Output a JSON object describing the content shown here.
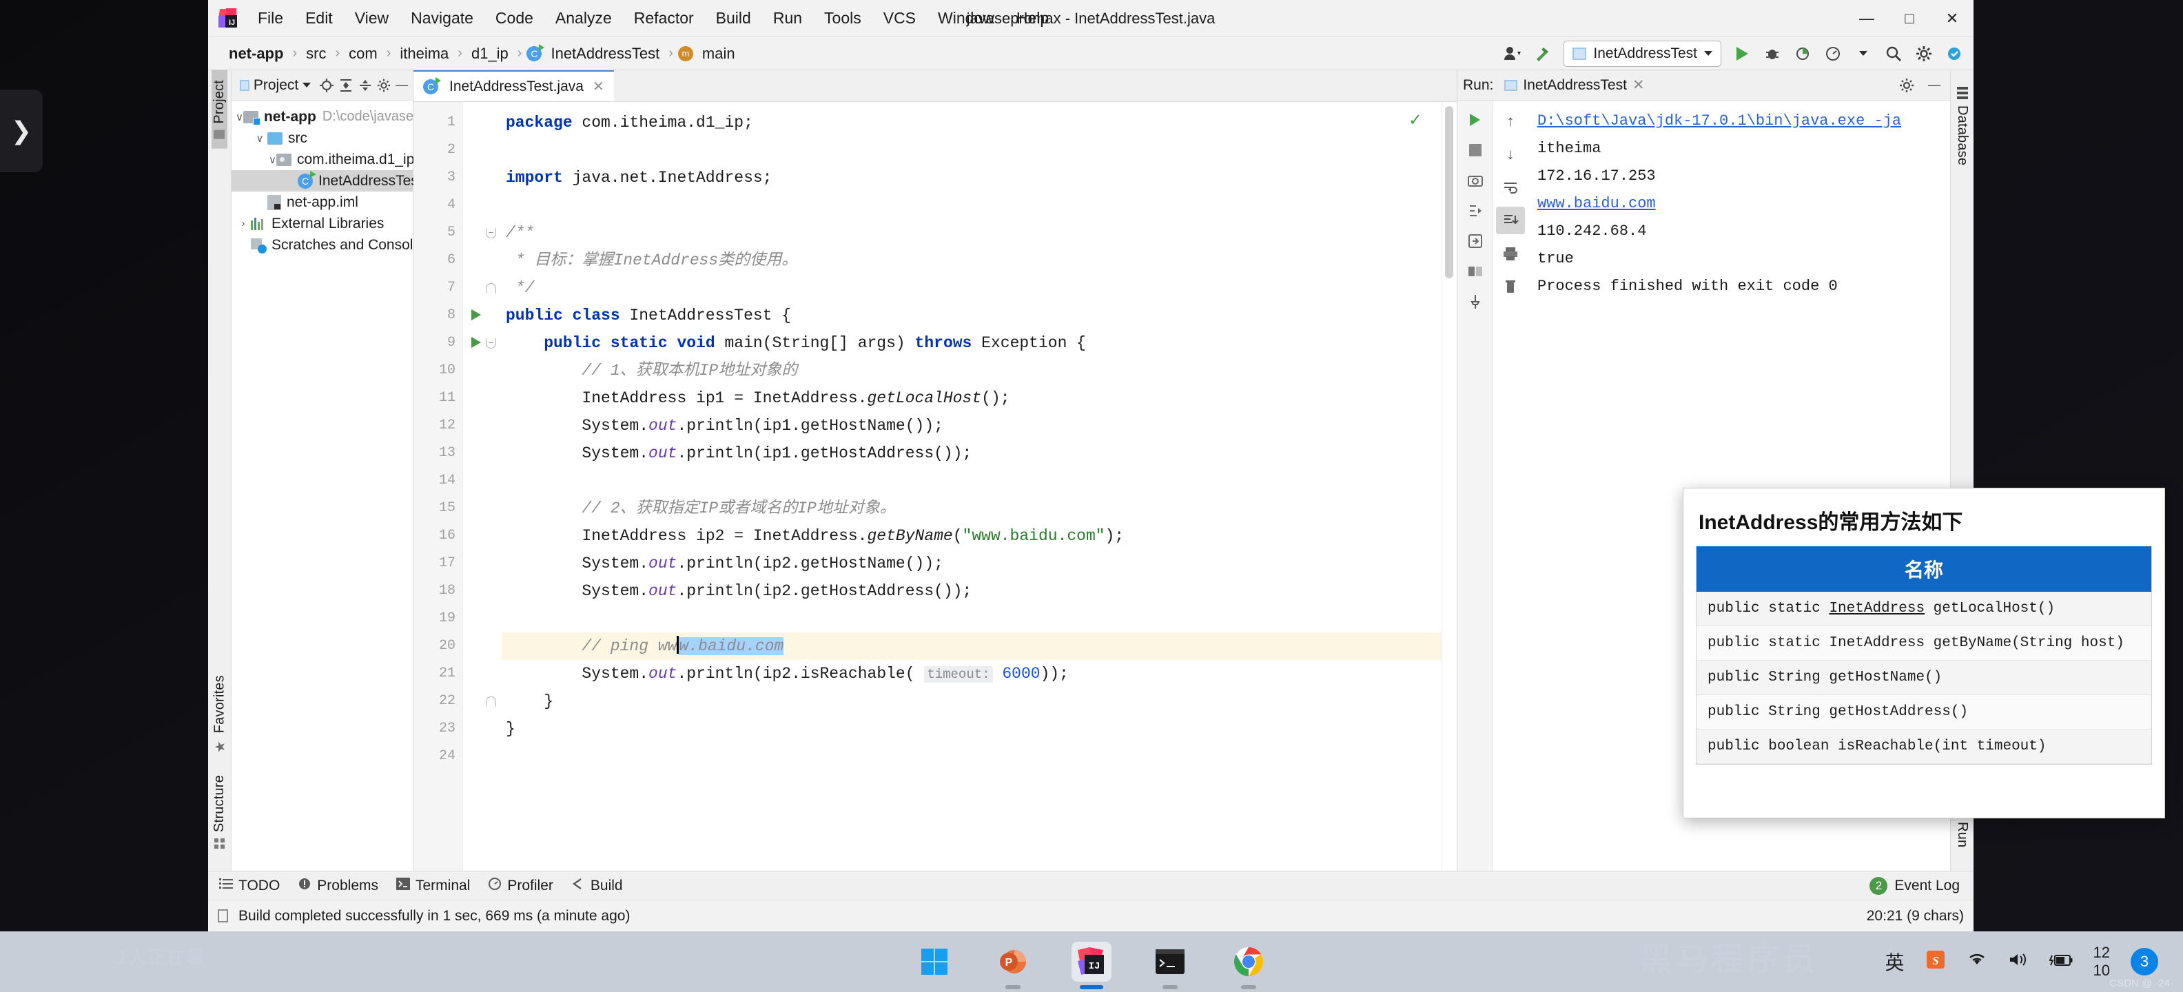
{
  "window": {
    "title": "javasepromax - InetAddressTest.java",
    "minimize": "—",
    "maximize": "□",
    "close": "✕"
  },
  "menu": [
    "File",
    "Edit",
    "View",
    "Navigate",
    "Code",
    "Analyze",
    "Refactor",
    "Build",
    "Run",
    "Tools",
    "VCS",
    "Window",
    "Help"
  ],
  "breadcrumb": {
    "items": [
      "net-app",
      "src",
      "com",
      "itheima",
      "d1_ip",
      "InetAddressTest",
      "main"
    ],
    "separator": "›",
    "class_icon_letter": "C",
    "method_icon_letter": "m"
  },
  "toolbar": {
    "run_config_name": "InetAddressTest",
    "icons": [
      "user-icon",
      "build-hammer-icon",
      "run-icon",
      "debug-icon",
      "run-coverage-icon",
      "profiler-icon",
      "search-icon",
      "settings-icon",
      "updates-icon"
    ]
  },
  "left_rail": {
    "tabs": [
      {
        "label": "Project",
        "active": true
      },
      {
        "label": "Structure",
        "active": false
      },
      {
        "label": "Favorites",
        "active": false
      }
    ]
  },
  "right_rail": {
    "tabs": [
      {
        "label": "Database",
        "active": false
      },
      {
        "label": "Run",
        "active": false
      }
    ]
  },
  "project_panel": {
    "title": "Project",
    "tree": [
      {
        "label": "net-app",
        "path": "D:\\code\\javasepromax\\net-app",
        "indent": 0,
        "twisty": "∨",
        "icon": "module-folder-icon",
        "bold": true,
        "selected": false
      },
      {
        "label": "src",
        "path": "",
        "indent": 1,
        "twisty": "∨",
        "icon": "source-folder-icon",
        "bold": false,
        "selected": false
      },
      {
        "label": "com.itheima.d1_ip",
        "path": "",
        "indent": 2,
        "twisty": "∨",
        "icon": "package-icon",
        "bold": false,
        "selected": false
      },
      {
        "label": "InetAddressTest",
        "path": "",
        "indent": 3,
        "twisty": "",
        "icon": "java-class-icon",
        "bold": false,
        "selected": true
      },
      {
        "label": "net-app.iml",
        "path": "",
        "indent": 1,
        "twisty": "",
        "icon": "iml-file-icon",
        "bold": false,
        "selected": false
      },
      {
        "label": "External Libraries",
        "path": "",
        "indent": 0,
        "twisty": "›",
        "icon": "library-icon",
        "bold": false,
        "selected": false
      },
      {
        "label": "Scratches and Consoles",
        "path": "",
        "indent": 0,
        "twisty": "",
        "icon": "scratches-icon",
        "bold": false,
        "selected": false
      }
    ]
  },
  "editor": {
    "tab_label": "InetAddressTest.java",
    "tab_close": "✕",
    "inspection_ok": "✓",
    "line_numbers": [
      "1",
      "2",
      "3",
      "4",
      "5",
      "6",
      "7",
      "8",
      "9",
      "10",
      "11",
      "12",
      "13",
      "14",
      "15",
      "16",
      "17",
      "18",
      "19",
      "20",
      "21",
      "22",
      "23",
      "24"
    ],
    "lines": [
      {
        "n": 1,
        "html": "<span class=\"kw\">package</span> com.itheima.d1_ip;"
      },
      {
        "n": 2,
        "html": ""
      },
      {
        "n": 3,
        "html": "<span class=\"kw\">import</span> java.net.InetAddress;"
      },
      {
        "n": 4,
        "html": ""
      },
      {
        "n": 5,
        "html": "<span class=\"cm\">/**</span>"
      },
      {
        "n": 6,
        "html": "<span class=\"cm\"> * 目标：掌握InetAddress类的使用。</span>"
      },
      {
        "n": 7,
        "html": "<span class=\"cm\"> */</span>"
      },
      {
        "n": 8,
        "html": "<span class=\"kw\">public class</span> InetAddressTest {"
      },
      {
        "n": 9,
        "html": "    <span class=\"kw\">public static void</span> main(String[] args) <span class=\"kw\">throws</span> Exception {"
      },
      {
        "n": 10,
        "html": "        <span class=\"cm\">// 1、获取本机IP地址对象的</span>"
      },
      {
        "n": 11,
        "html": "        InetAddress ip1 = InetAddress.<span class=\"mth\">getLocalHost</span>();"
      },
      {
        "n": 12,
        "html": "        System.<span class=\"fld\">out</span>.println(ip1.getHostName());"
      },
      {
        "n": 13,
        "html": "        System.<span class=\"fld\">out</span>.println(ip1.getHostAddress());"
      },
      {
        "n": 14,
        "html": ""
      },
      {
        "n": 15,
        "html": "        <span class=\"cm\">// 2、获取指定IP或者域名的IP地址对象。</span>"
      },
      {
        "n": 16,
        "html": "        InetAddress ip2 = InetAddress.<span class=\"mth\">getByName</span>(<span class=\"st\">\"www.baidu.com\"</span>);"
      },
      {
        "n": 17,
        "html": "        System.<span class=\"fld\">out</span>.println(ip2.getHostName());"
      },
      {
        "n": 18,
        "html": "        System.<span class=\"fld\">out</span>.println(ip2.getHostAddress());"
      },
      {
        "n": 19,
        "html": ""
      },
      {
        "n": 20,
        "html": "        <span class=\"cm\">// ping</span> <span class=\"cm\">ww</span><span class=\"caret-bar\"></span><span class=\"cm sel\">w.baidu.com</span>",
        "highlight": true
      },
      {
        "n": 21,
        "html": "        System.<span class=\"fld\">out</span>.println(ip2.isReachable( <span class=\"hint\">timeout:</span> <span class=\"num\">6000</span>));"
      },
      {
        "n": 22,
        "html": "    }"
      },
      {
        "n": 23,
        "html": "}"
      },
      {
        "n": 24,
        "html": ""
      }
    ],
    "run_markers": [
      8,
      9
    ],
    "code_text": {
      "l1": "package com.itheima.d1_ip;",
      "l3": "import java.net.InetAddress;",
      "l5": "/**",
      "l6": " * 目标：掌握InetAddress类的使用。",
      "l7": " */",
      "l8": "public class InetAddressTest {",
      "l9": "    public static void main(String[] args) throws Exception {",
      "l10": "        // 1、获取本机IP地址对象的",
      "l11": "        InetAddress ip1 = InetAddress.getLocalHost();",
      "l12": "        System.out.println(ip1.getHostName());",
      "l13": "        System.out.println(ip1.getHostAddress());",
      "l15": "        // 2、获取指定IP或者域名的IP地址对象。",
      "l16": "        InetAddress ip2 = InetAddress.getByName(\"www.baidu.com\");",
      "l17": "        System.out.println(ip2.getHostName());",
      "l18": "        System.out.println(ip2.getHostAddress());",
      "l20": "        // ping www.baidu.com",
      "l21": "        System.out.println(ip2.isReachable( timeout: 6000));",
      "l22": "    }",
      "l23": "}"
    }
  },
  "run_panel": {
    "label": "Run:",
    "tab_name": "InetAddressTest",
    "tab_close": "✕",
    "console_lines": [
      {
        "text": "D:\\soft\\Java\\jdk-17.0.1\\bin\\java.exe -ja",
        "link": true
      },
      {
        "text": "itheima",
        "link": false
      },
      {
        "text": "172.16.17.253",
        "link": false
      },
      {
        "text": "www.baidu.com",
        "link": true
      },
      {
        "text": "110.242.68.4",
        "link": false
      },
      {
        "text": "true",
        "link": false
      },
      {
        "text": "",
        "link": false
      },
      {
        "text": "Process finished with exit code 0",
        "link": false
      }
    ],
    "tool_icons": [
      "rerun-icon",
      "stop-icon",
      "camera-icon",
      "thread-dump-icon",
      "export-icon",
      "layout-icon",
      "pin-icon"
    ],
    "side_icons": [
      "up-arrow-icon",
      "down-arrow-icon",
      "soft-wrap-icon",
      "scroll-to-end-icon",
      "print-icon",
      "trash-icon"
    ],
    "settings_icon": "gear-icon",
    "hide_icon": "minimize-icon"
  },
  "popup": {
    "title": "InetAddress的常用方法如下",
    "header": "名称",
    "header_color": "#1068c4",
    "rows": [
      "public static InetAddress getLocalHost()",
      "public static InetAddress getByName(String host)",
      "public String getHostName()",
      "public String getHostAddress()",
      "public boolean isReachable(int timeout)"
    ]
  },
  "tool_window_bar": {
    "items": [
      {
        "label": "TODO",
        "icon": "todo-icon"
      },
      {
        "label": "Problems",
        "icon": "problems-icon"
      },
      {
        "label": "Terminal",
        "icon": "terminal-icon"
      },
      {
        "label": "Profiler",
        "icon": "profiler-icon"
      },
      {
        "label": "Build",
        "icon": "build-icon"
      }
    ],
    "event_log": {
      "label": "Event Log",
      "count": "2"
    }
  },
  "status_bar": {
    "message": "Build completed successfully in 1 sec, 669 ms (a minute ago)",
    "caret_position": "20:21 (9 chars)",
    "right_icons": [
      "performance-icon",
      "ime-cn-icon",
      "moon-icon",
      "notifications-icon",
      "keyboard-icon",
      "settings-icon"
    ]
  },
  "taskbar": {
    "apps": [
      {
        "name": "windows-start-icon",
        "active": false
      },
      {
        "name": "powerpoint-icon",
        "active": false
      },
      {
        "name": "intellij-idea-icon",
        "active": true
      },
      {
        "name": "terminal-icon",
        "active": false
      },
      {
        "name": "google-chrome-icon",
        "active": false
      }
    ],
    "tray": [
      "ime-english-icon",
      "sogou-input-icon",
      "wifi-icon",
      "volume-icon",
      "battery-charging-icon"
    ],
    "clock_time": "12",
    "clock_date": "10",
    "notification_count": "3"
  },
  "desktop": {
    "side_arrow": "❯",
    "wallpaper_left": "1人正在看",
    "wallpaper_right": "黑马程序员",
    "watermark": "CSDN @ ·24·"
  }
}
